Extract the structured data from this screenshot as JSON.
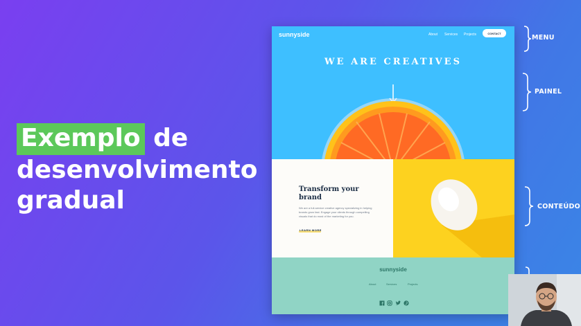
{
  "slide": {
    "title_highlight": "Exemplo",
    "title_line1_rest": " de",
    "title_line2": "desenvolvimento",
    "title_line3": "gradual"
  },
  "mockup": {
    "nav": {
      "logo": "sunnyside",
      "links": [
        "About",
        "Services",
        "Projects"
      ],
      "cta": "CONTACT"
    },
    "hero": {
      "title": "WE ARE CREATIVES"
    },
    "content": {
      "title": "Transform your brand",
      "body": "We are a full-service creative agency specializing in helping brands grow fast. Engage your clients through compelling visuals that do most of the marketing for you.",
      "link": "LEARN MORE"
    },
    "footer": {
      "logo": "sunnyside",
      "links": [
        "About",
        "Services",
        "Projects"
      ],
      "social_icons": [
        "facebook-icon",
        "instagram-icon",
        "twitter-icon",
        "pinterest-icon"
      ]
    }
  },
  "annotations": {
    "menu": "MENU",
    "painel": "PAINEL",
    "conteudo": "CONTEÚDO"
  },
  "colors": {
    "hero": "#3ebfff",
    "highlight": "#5cc85a",
    "egg_panel": "#fdd21f",
    "footer": "#90d4c5"
  }
}
